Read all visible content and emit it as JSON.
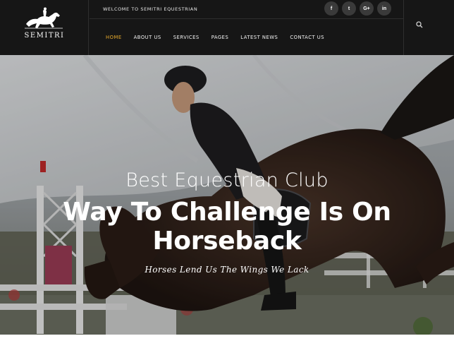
{
  "brand": {
    "name": "SEMITRI"
  },
  "topbar": {
    "welcome": "WELCOME TO SEMITRI EQUESTRIAN",
    "socials": [
      {
        "icon": "facebook-icon",
        "glyph": "f"
      },
      {
        "icon": "twitter-icon",
        "glyph": "t"
      },
      {
        "icon": "google-plus-icon",
        "glyph": "G+"
      },
      {
        "icon": "linkedin-icon",
        "glyph": "in"
      }
    ]
  },
  "nav": {
    "items": [
      "HOME",
      "ABOUT US",
      "SERVICES",
      "PAGES",
      "LATEST NEWS",
      "CONTACT US"
    ],
    "active_index": 0
  },
  "hero": {
    "kicker": "Best Equestrian Club",
    "title": "Way To Challenge Is On Horseback",
    "tagline": "Horses Lend Us The Wings We Lack"
  },
  "colors": {
    "header_bg": "#161616",
    "accent": "#e5a92c",
    "text_light": "#ffffff"
  }
}
